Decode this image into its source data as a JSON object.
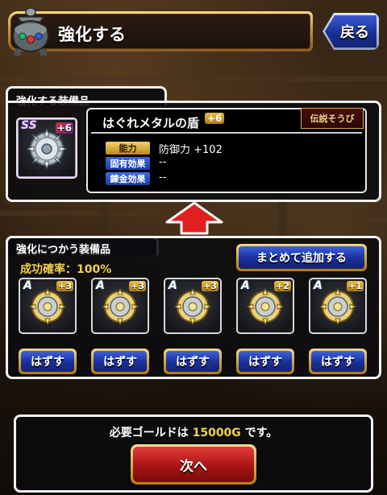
{
  "header": {
    "title": "強化する",
    "back_label": "戻る"
  },
  "target_panel": {
    "heading": "強化する装備品",
    "item": {
      "rank": "SS",
      "plus": "+6",
      "name": "はぐれメタルの盾",
      "name_plus": "+6",
      "rarity_tag": "伝説そうび",
      "stats": [
        {
          "label": "能力",
          "value": "防御力 +102"
        },
        {
          "label": "固有効果",
          "value": "--"
        },
        {
          "label": "錬金効果",
          "value": "--"
        }
      ]
    }
  },
  "material_panel": {
    "heading": "強化につかう装備品",
    "success_rate": "成功確率：100%",
    "add_all_label": "まとめて追加する",
    "items": [
      {
        "rank": "A",
        "plus": "+3",
        "remove_label": "はずす"
      },
      {
        "rank": "A",
        "plus": "+3",
        "remove_label": "はずす"
      },
      {
        "rank": "A",
        "plus": "+3",
        "remove_label": "はずす"
      },
      {
        "rank": "A",
        "plus": "+2",
        "remove_label": "はずす"
      },
      {
        "rank": "A",
        "plus": "+1",
        "remove_label": "はずす"
      }
    ]
  },
  "footer": {
    "gold_prefix": "必要ゴールドは ",
    "gold_amount": "15000G",
    "gold_suffix": " です。",
    "next_label": "次へ"
  }
}
